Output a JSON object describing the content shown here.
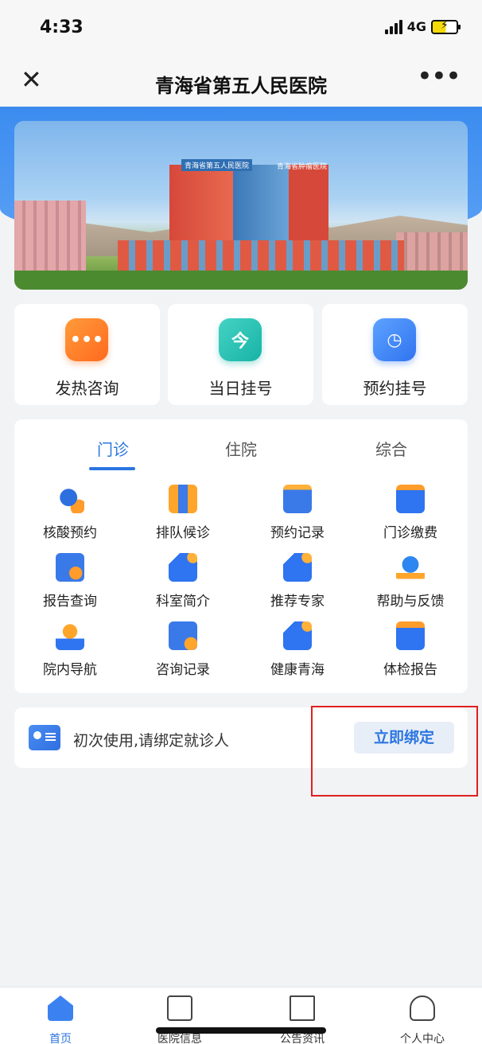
{
  "status": {
    "time": "4:33",
    "network": "4G"
  },
  "nav": {
    "close_glyph": "✕",
    "title": "青海省第五人民医院",
    "more_glyph": "•••"
  },
  "banner": {
    "sign_left": "青海省第五人民医院",
    "sign_right": "青海省肿瘤医院"
  },
  "quick_actions": [
    {
      "label": "发热咨询",
      "icon": "chat-icon",
      "glyph": "•••"
    },
    {
      "label": "当日挂号",
      "icon": "calendar-today-icon",
      "glyph": "今"
    },
    {
      "label": "预约挂号",
      "icon": "calendar-clock-icon",
      "glyph": "◷"
    }
  ],
  "tabs": [
    {
      "label": "门诊",
      "active": true
    },
    {
      "label": "住院",
      "active": false
    },
    {
      "label": "综合",
      "active": false
    }
  ],
  "services": [
    {
      "label": "核酸预约",
      "icon": "gear-clock-icon"
    },
    {
      "label": "排队候诊",
      "icon": "queue-people-icon"
    },
    {
      "label": "预约记录",
      "icon": "notepad-icon"
    },
    {
      "label": "门诊缴费",
      "icon": "yuan-wallet-icon"
    },
    {
      "label": "报告查询",
      "icon": "report-search-icon"
    },
    {
      "label": "科室简介",
      "icon": "thumbs-up-icon"
    },
    {
      "label": "推荐专家",
      "icon": "thumbs-up-icon"
    },
    {
      "label": "帮助与反馈",
      "icon": "lightbulb-icon"
    },
    {
      "label": "院内导航",
      "icon": "location-pin-icon"
    },
    {
      "label": "咨询记录",
      "icon": "checklist-icon"
    },
    {
      "label": "健康青海",
      "icon": "thumbs-up-icon"
    },
    {
      "label": "体检报告",
      "icon": "folder-plus-icon"
    }
  ],
  "bind_card": {
    "text": "初次使用,请绑定就诊人",
    "button": "立即绑定",
    "icon": "id-card-icon"
  },
  "tabbar": [
    {
      "label": "首页",
      "icon": "home-icon",
      "active": true
    },
    {
      "label": "医院信息",
      "icon": "document-icon",
      "active": false
    },
    {
      "label": "公告资讯",
      "icon": "notice-board-icon",
      "active": false
    },
    {
      "label": "个人中心",
      "icon": "user-icon",
      "active": false
    }
  ],
  "colors": {
    "accent": "#2b75e0",
    "highlight": "#e02020",
    "background": "#f2f3f5"
  }
}
